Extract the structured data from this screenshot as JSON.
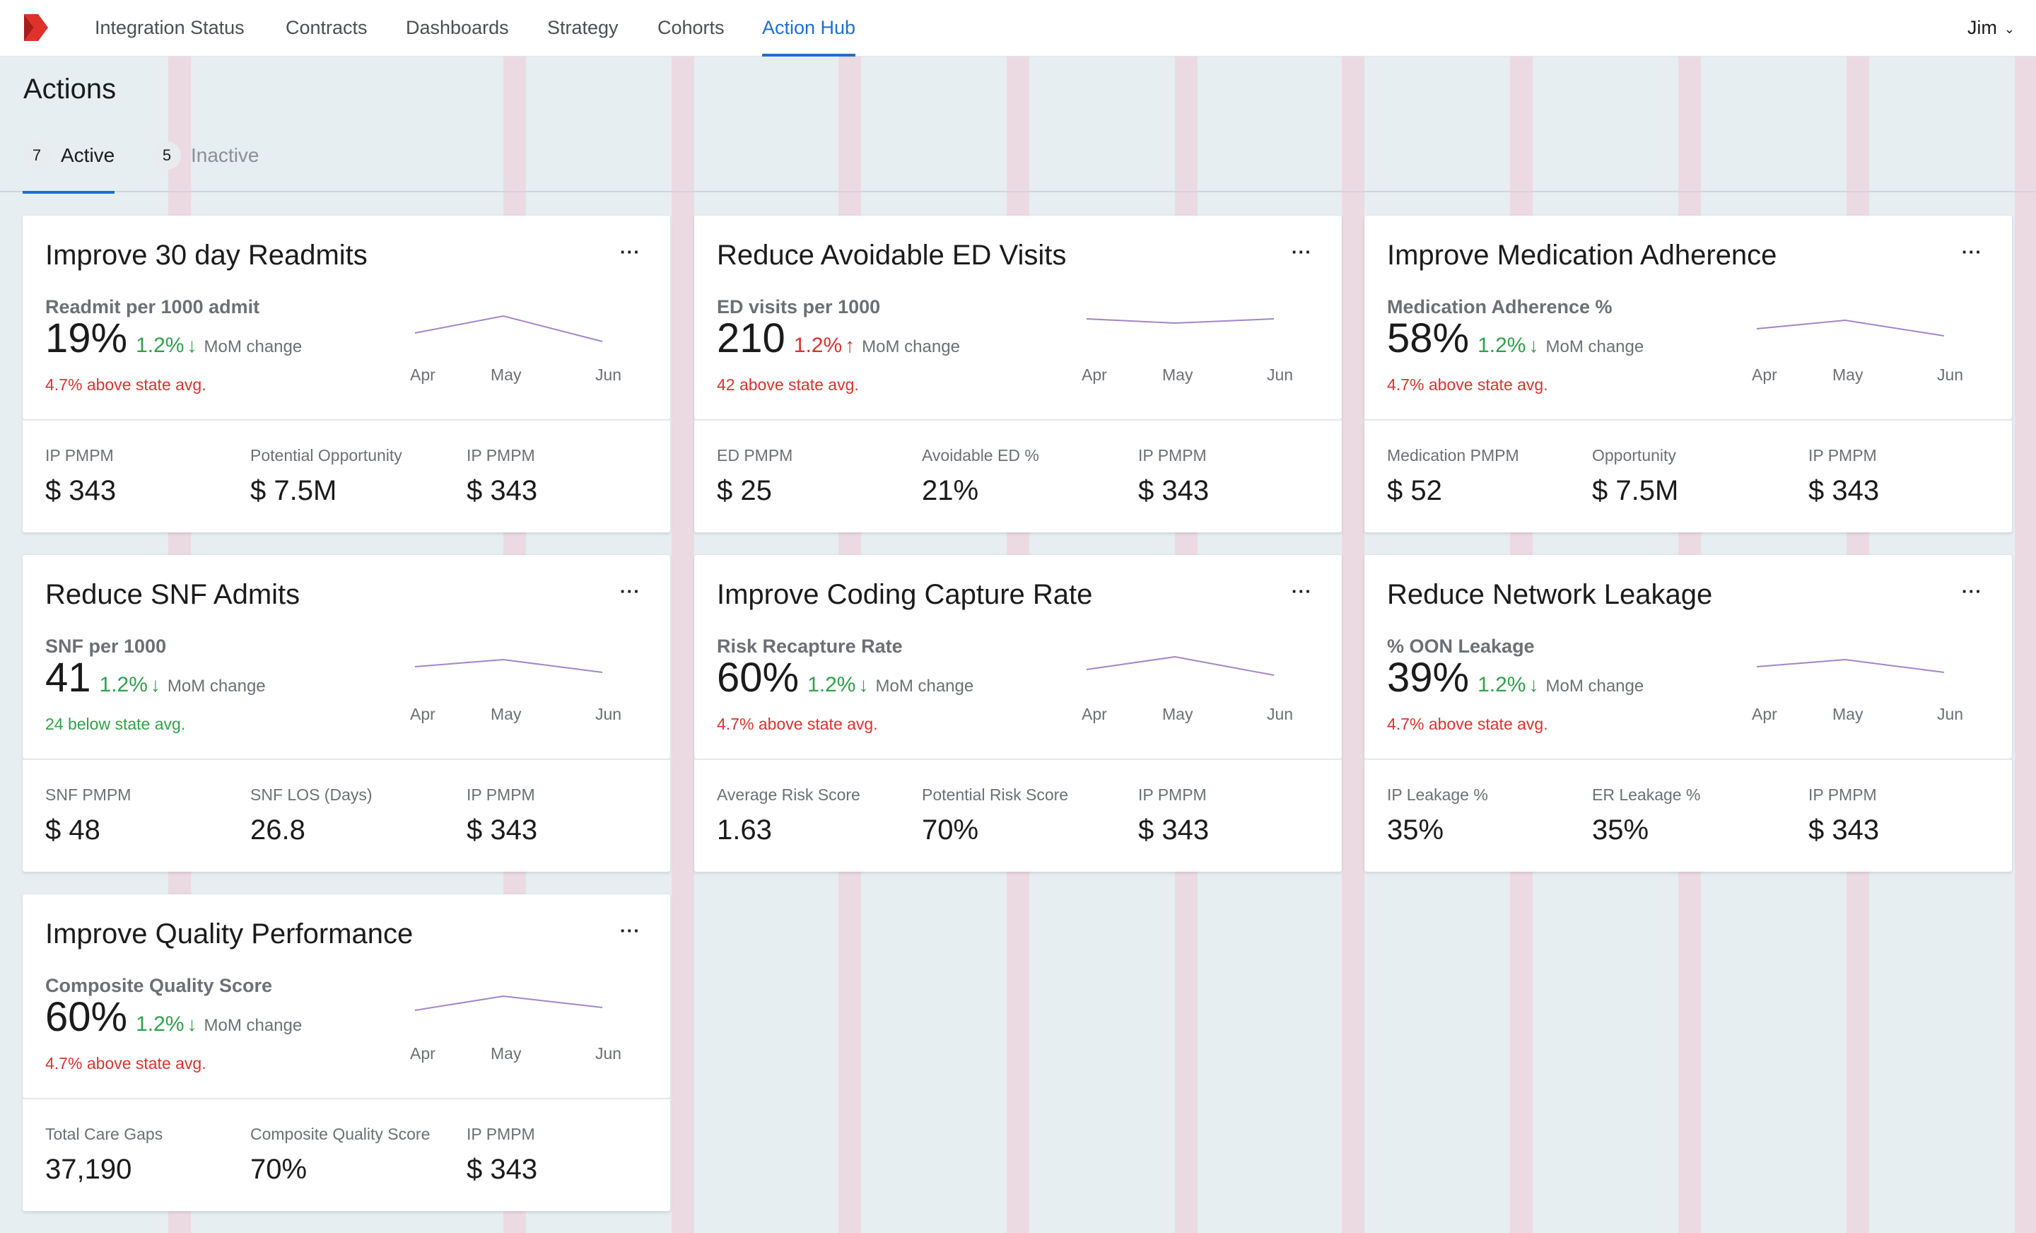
{
  "nav": {
    "items": [
      "Integration Status",
      "Contracts",
      "Dashboards",
      "Strategy",
      "Cohorts",
      "Action Hub"
    ],
    "active": "Action Hub",
    "user": "Jim"
  },
  "page": {
    "title": "Actions",
    "tabs": [
      {
        "count": "7",
        "label": "Active"
      },
      {
        "count": "5",
        "label": "Inactive"
      }
    ]
  },
  "colors": {
    "accent": "#1e6fd0",
    "positive": "#2ea34a",
    "negative": "#e0312b",
    "sparkline": "#a386c9",
    "logo": "#e0312b"
  },
  "cards": [
    {
      "title": "Improve 30 day Readmits",
      "metric_name": "Readmit per 1000 admit",
      "value": "19%",
      "change": "1.2%",
      "change_dir": "down",
      "change_color": "green",
      "mom_label": "MoM change",
      "state_avg": "4.7% above state avg.",
      "state_avg_color": "red",
      "spark_labels": [
        "Apr",
        "May",
        "Jun"
      ],
      "spark_values": [
        0.3,
        0.9,
        0.0
      ],
      "stats": [
        {
          "label": "IP PMPM",
          "value": "$ 343"
        },
        {
          "label": "Potential Opportunity",
          "value": "$ 7.5M"
        },
        {
          "label": "IP PMPM",
          "value": "$ 343"
        }
      ]
    },
    {
      "title": "Reduce Avoidable ED Visits",
      "metric_name": "ED visits per 1000",
      "value": "210",
      "change": "1.2%",
      "change_dir": "up",
      "change_color": "red",
      "mom_label": "MoM change",
      "state_avg": "42 above state avg.",
      "state_avg_color": "red",
      "spark_labels": [
        "Apr",
        "May",
        "Jun"
      ],
      "spark_values": [
        0.8,
        0.65,
        0.8
      ],
      "stats": [
        {
          "label": "ED PMPM",
          "value": "$ 25"
        },
        {
          "label": "Avoidable ED %",
          "value": "21%"
        },
        {
          "label": "IP PMPM",
          "value": "$ 343"
        }
      ]
    },
    {
      "title": "Improve Medication Adherence",
      "metric_name": "Medication Adherence %",
      "value": "58%",
      "change": "1.2%",
      "change_dir": "down",
      "change_color": "green",
      "mom_label": "MoM change",
      "state_avg": "4.7% above state avg.",
      "state_avg_color": "red",
      "spark_labels": [
        "Apr",
        "May",
        "Jun"
      ],
      "spark_values": [
        0.45,
        0.75,
        0.2
      ],
      "stats": [
        {
          "label": "Medication PMPM",
          "value": "$ 52"
        },
        {
          "label": "Opportunity",
          "value": "$ 7.5M"
        },
        {
          "label": "IP PMPM",
          "value": "$ 343"
        }
      ]
    },
    {
      "title": "Reduce SNF Admits",
      "metric_name": "SNF per 1000",
      "value": "41",
      "change": "1.2%",
      "change_dir": "down",
      "change_color": "green",
      "mom_label": "MoM change",
      "state_avg": "24 below state avg.",
      "state_avg_color": "green",
      "spark_labels": [
        "Apr",
        "May",
        "Jun"
      ],
      "spark_values": [
        0.5,
        0.75,
        0.3
      ],
      "stats": [
        {
          "label": "SNF PMPM",
          "value": "$ 48"
        },
        {
          "label": "SNF LOS (Days)",
          "value": "26.8"
        },
        {
          "label": "IP PMPM",
          "value": "$ 343"
        }
      ]
    },
    {
      "title": "Improve Coding Capture Rate",
      "metric_name": "Risk Recapture Rate",
      "value": "60%",
      "change": "1.2%",
      "change_dir": "down",
      "change_color": "green",
      "mom_label": "MoM change",
      "state_avg": "4.7% above state avg.",
      "state_avg_color": "red",
      "spark_labels": [
        "Apr",
        "May",
        "Jun"
      ],
      "spark_values": [
        0.4,
        0.85,
        0.2
      ],
      "stats": [
        {
          "label": "Average Risk Score",
          "value": "1.63"
        },
        {
          "label": "Potential Risk Score",
          "value": "70%"
        },
        {
          "label": "IP PMPM",
          "value": "$ 343"
        }
      ]
    },
    {
      "title": "Reduce Network Leakage",
      "metric_name": "% OON Leakage",
      "value": "39%",
      "change": "1.2%",
      "change_dir": "down",
      "change_color": "green",
      "mom_label": "MoM change",
      "state_avg": "4.7% above state avg.",
      "state_avg_color": "red",
      "spark_labels": [
        "Apr",
        "May",
        "Jun"
      ],
      "spark_values": [
        0.5,
        0.75,
        0.3
      ],
      "stats": [
        {
          "label": "IP Leakage %",
          "value": "35%"
        },
        {
          "label": "ER Leakage %",
          "value": "35%"
        },
        {
          "label": "IP PMPM",
          "value": "$ 343"
        }
      ]
    },
    {
      "title": "Improve Quality Performance",
      "metric_name": "Composite Quality Score",
      "value": "60%",
      "change": "1.2%",
      "change_dir": "down",
      "change_color": "green",
      "mom_label": "MoM change",
      "state_avg": "4.7% above state avg.",
      "state_avg_color": "red",
      "spark_labels": [
        "Apr",
        "May",
        "Jun"
      ],
      "spark_values": [
        0.35,
        0.85,
        0.45
      ],
      "stats": [
        {
          "label": "Total Care Gaps",
          "value": "37,190"
        },
        {
          "label": "Composite Quality Score",
          "value": "70%"
        },
        {
          "label": "IP PMPM",
          "value": "$ 343"
        }
      ]
    }
  ]
}
